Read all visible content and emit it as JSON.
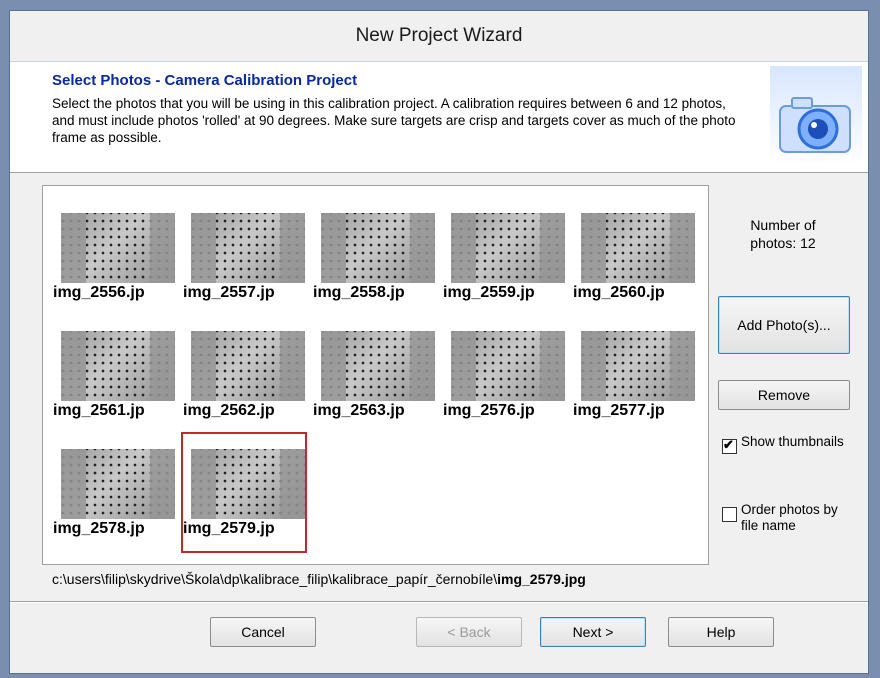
{
  "window": {
    "title": "New Project Wizard"
  },
  "header": {
    "title": "Select Photos - Camera Calibration Project",
    "description": "Select the photos that you will be using in this calibration project. A calibration requires between 6 and 12 photos, and must include photos 'rolled' at 90 degrees. Make sure targets are crisp and targets cover as much of the photo frame as possible.",
    "icon": "camera-icon"
  },
  "photos": [
    {
      "name": "img_2556.jp"
    },
    {
      "name": "img_2557.jp"
    },
    {
      "name": "img_2558.jp"
    },
    {
      "name": "img_2559.jp"
    },
    {
      "name": "img_2560.jp"
    },
    {
      "name": "img_2561.jp"
    },
    {
      "name": "img_2562.jp"
    },
    {
      "name": "img_2563.jp"
    },
    {
      "name": "img_2576.jp"
    },
    {
      "name": "img_2577.jp"
    },
    {
      "name": "img_2578.jp"
    },
    {
      "name": "img_2579.jp",
      "selected": true
    }
  ],
  "sidebar": {
    "count_label": "Number of photos: 12",
    "add_label": "Add Photo(s)...",
    "remove_label": "Remove",
    "show_thumbnails_label": "Show thumbnails",
    "show_thumbnails_checked": true,
    "order_label": "Order photos by file name",
    "order_checked": false
  },
  "path": {
    "dir": "c:\\users\\filip\\skydrive\\Škola\\dp\\kalibrace_filip\\kalibrace_papír_černobíle\\",
    "file": "img_2579.jpg"
  },
  "footer": {
    "cancel_label": "Cancel",
    "back_label": "< Back",
    "next_label": "Next >",
    "help_label": "Help"
  }
}
